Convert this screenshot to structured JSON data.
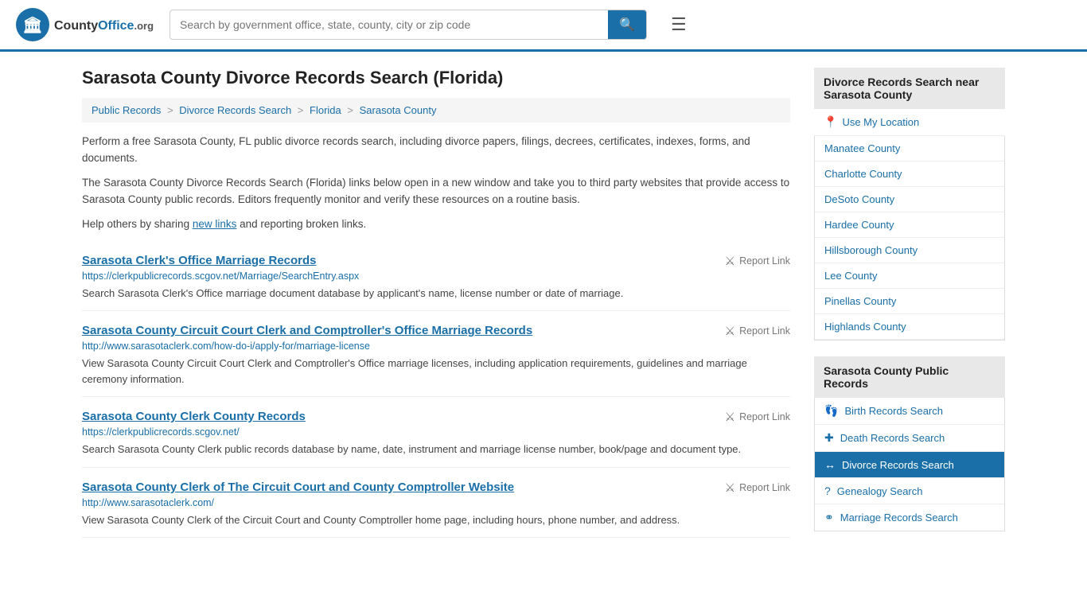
{
  "header": {
    "logo_icon": "🏛",
    "logo_name": "CountyOffice",
    "logo_ext": ".org",
    "search_placeholder": "Search by government office, state, county, city or zip code",
    "search_value": ""
  },
  "page": {
    "title": "Sarasota County Divorce Records Search (Florida)",
    "breadcrumb": [
      {
        "label": "Public Records",
        "href": "#"
      },
      {
        "label": "Divorce Records Search",
        "href": "#"
      },
      {
        "label": "Florida",
        "href": "#"
      },
      {
        "label": "Sarasota County",
        "href": "#"
      }
    ],
    "desc1": "Perform a free Sarasota County, FL public divorce records search, including divorce papers, filings, decrees, certificates, indexes, forms, and documents.",
    "desc2": "The Sarasota County Divorce Records Search (Florida) links below open in a new window and take you to third party websites that provide access to Sarasota County public records. Editors frequently monitor and verify these resources on a routine basis.",
    "desc3_before": "Help others by sharing ",
    "desc3_link": "new links",
    "desc3_after": " and reporting broken links."
  },
  "results": [
    {
      "title": "Sarasota Clerk's Office Marriage Records",
      "url": "https://clerkpublicrecords.scgov.net/Marriage/SearchEntry.aspx",
      "desc": "Search Sarasota Clerk's Office marriage document database by applicant's name, license number or date of marriage."
    },
    {
      "title": "Sarasota County Circuit Court Clerk and Comptroller's Office Marriage Records",
      "url": "http://www.sarasotaclerk.com/how-do-i/apply-for/marriage-license",
      "desc": "View Sarasota County Circuit Court Clerk and Comptroller's Office marriage licenses, including application requirements, guidelines and marriage ceremony information."
    },
    {
      "title": "Sarasota County Clerk County Records",
      "url": "https://clerkpublicrecords.scgov.net/",
      "desc": "Search Sarasota County Clerk public records database by name, date, instrument and marriage license number, book/page and document type."
    },
    {
      "title": "Sarasota County Clerk of The Circuit Court and County Comptroller Website",
      "url": "http://www.sarasotaclerk.com/",
      "desc": "View Sarasota County Clerk of the Circuit Court and County Comptroller home page, including hours, phone number, and address."
    }
  ],
  "sidebar": {
    "nearby_heading": "Divorce Records Search near Sarasota County",
    "use_location": "Use My Location",
    "nearby_counties": [
      "Manatee County",
      "Charlotte County",
      "DeSoto County",
      "Hardee County",
      "Hillsborough County",
      "Lee County",
      "Pinellas County",
      "Highlands County"
    ],
    "public_records_heading": "Sarasota County Public Records",
    "public_records_links": [
      {
        "icon": "👣",
        "label": "Birth Records Search",
        "active": false
      },
      {
        "icon": "✚",
        "label": "Death Records Search",
        "active": false
      },
      {
        "icon": "↔",
        "label": "Divorce Records Search",
        "active": true
      },
      {
        "icon": "?",
        "label": "Genealogy Search",
        "active": false
      },
      {
        "icon": "⚭",
        "label": "Marriage Records Search",
        "active": false
      }
    ]
  }
}
